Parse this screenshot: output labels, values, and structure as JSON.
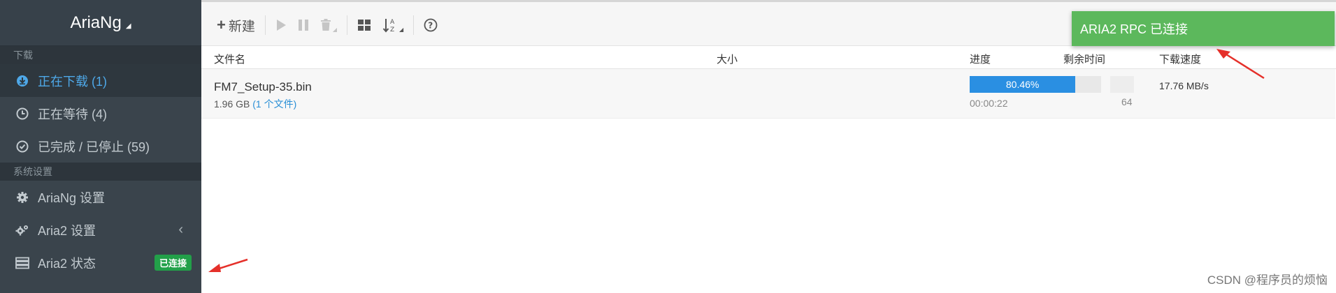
{
  "app": {
    "title": "AriaNg"
  },
  "sidebar": {
    "section_download": "下载",
    "items": [
      {
        "label": "正在下载 (1)",
        "icon": "download-circle-icon"
      },
      {
        "label": "正在等待 (4)",
        "icon": "clock-icon"
      },
      {
        "label": "已完成 / 已停止 (59)",
        "icon": "check-circle-icon"
      }
    ],
    "section_settings": "系统设置",
    "settings_items": [
      {
        "label": "AriaNg 设置",
        "icon": "gear-icon"
      },
      {
        "label": "Aria2 设置",
        "icon": "gears-icon"
      },
      {
        "label": "Aria2 状态",
        "icon": "server-icon",
        "badge": "已连接"
      }
    ]
  },
  "toolbar": {
    "new_label": "新建"
  },
  "toast": {
    "message": "ARIA2 RPC 已连接"
  },
  "table": {
    "columns": [
      "文件名",
      "大小",
      "进度",
      "剩余时间",
      "下载速度"
    ],
    "rows": [
      {
        "name": "FM7_Setup-35.bin",
        "size": "1.96 GB",
        "files": "(1 个文件)",
        "progress_text": "80.46%",
        "progress": 80.46,
        "elapsed": "00:00:22",
        "connections": "64",
        "speed": "17.76 MB/s"
      }
    ]
  },
  "watermark": "CSDN @程序员的烦恼",
  "colors": {
    "accent": "#2a8fe2",
    "toast": "#5cb85c",
    "badge": "#22a049",
    "sidebar": "#3a444c"
  }
}
